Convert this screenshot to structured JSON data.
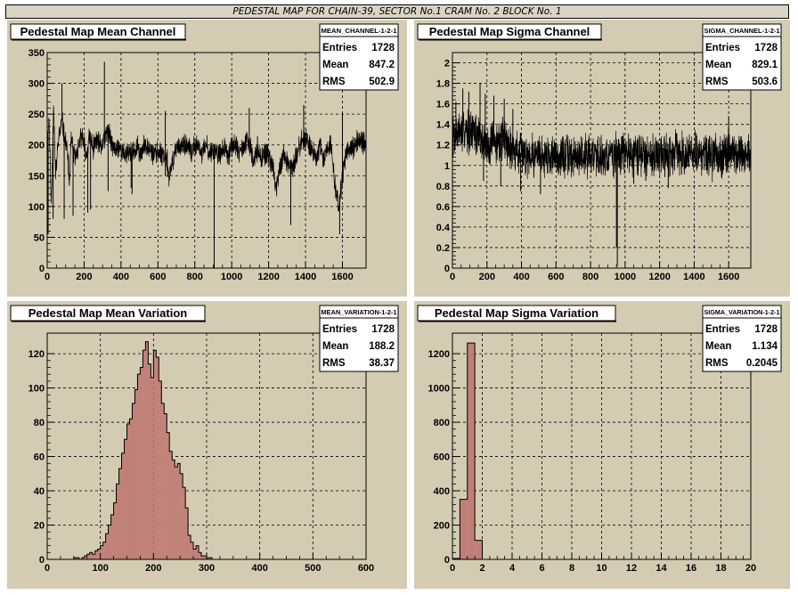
{
  "page": {
    "title": "PEDESTAL MAP FOR CHAIN-39, SECTOR No.1 CRAM No. 2 BLOCK No. 1"
  },
  "colors": {
    "pad_background": "#d4cbb3",
    "histogram_fill": "#c08078",
    "line": "#000000"
  },
  "chart_data": [
    {
      "type": "line",
      "title": "Pedestal Map Mean Channel",
      "stats": {
        "name": "MEAN_CHANNEL-1-2-1",
        "entries": "1728",
        "mean": "847.2",
        "rms": "502.9"
      },
      "xlim": [
        0,
        1728
      ],
      "ylim": [
        0,
        350
      ],
      "xticks": [
        0,
        200,
        400,
        600,
        800,
        1000,
        1200,
        1400,
        1600
      ],
      "yticks": [
        0,
        50,
        100,
        150,
        200,
        250,
        300,
        350
      ],
      "grid": true,
      "stats_placement": "top-right",
      "profile": [
        [
          0,
          190
        ],
        [
          10,
          245
        ],
        [
          22,
          100
        ],
        [
          35,
          270
        ],
        [
          45,
          150
        ],
        [
          60,
          205
        ],
        [
          80,
          240
        ],
        [
          95,
          210
        ],
        [
          110,
          190
        ],
        [
          120,
          135
        ],
        [
          130,
          210
        ],
        [
          150,
          175
        ],
        [
          170,
          200
        ],
        [
          190,
          215
        ],
        [
          210,
          180
        ],
        [
          230,
          215
        ],
        [
          250,
          195
        ],
        [
          270,
          210
        ],
        [
          290,
          195
        ],
        [
          310,
          210
        ],
        [
          330,
          225
        ],
        [
          350,
          200
        ],
        [
          370,
          190
        ],
        [
          390,
          200
        ],
        [
          410,
          185
        ],
        [
          430,
          185
        ],
        [
          450,
          190
        ],
        [
          470,
          185
        ],
        [
          490,
          195
        ],
        [
          510,
          185
        ],
        [
          530,
          200
        ],
        [
          550,
          200
        ],
        [
          570,
          185
        ],
        [
          590,
          185
        ],
        [
          610,
          190
        ],
        [
          630,
          185
        ],
        [
          650,
          180
        ],
        [
          660,
          140
        ],
        [
          680,
          175
        ],
        [
          700,
          195
        ],
        [
          720,
          200
        ],
        [
          740,
          195
        ],
        [
          760,
          200
        ],
        [
          780,
          185
        ],
        [
          800,
          200
        ],
        [
          820,
          195
        ],
        [
          840,
          185
        ],
        [
          860,
          200
        ],
        [
          880,
          185
        ],
        [
          900,
          195
        ],
        [
          920,
          190
        ],
        [
          940,
          185
        ],
        [
          960,
          195
        ],
        [
          980,
          180
        ],
        [
          1000,
          200
        ],
        [
          1020,
          200
        ],
        [
          1040,
          185
        ],
        [
          1060,
          195
        ],
        [
          1080,
          205
        ],
        [
          1100,
          195
        ],
        [
          1120,
          175
        ],
        [
          1140,
          195
        ],
        [
          1160,
          180
        ],
        [
          1180,
          185
        ],
        [
          1200,
          180
        ],
        [
          1220,
          170
        ],
        [
          1240,
          130
        ],
        [
          1260,
          160
        ],
        [
          1280,
          185
        ],
        [
          1300,
          175
        ],
        [
          1320,
          165
        ],
        [
          1340,
          165
        ],
        [
          1360,
          195
        ],
        [
          1380,
          205
        ],
        [
          1400,
          210
        ],
        [
          1420,
          200
        ],
        [
          1440,
          190
        ],
        [
          1460,
          175
        ],
        [
          1480,
          200
        ],
        [
          1500,
          170
        ],
        [
          1520,
          200
        ],
        [
          1540,
          200
        ],
        [
          1560,
          135
        ],
        [
          1580,
          100
        ],
        [
          1600,
          145
        ],
        [
          1620,
          190
        ],
        [
          1640,
          195
        ],
        [
          1660,
          195
        ],
        [
          1680,
          205
        ],
        [
          1700,
          205
        ],
        [
          1728,
          205
        ]
      ],
      "spikes": [
        [
          5,
          55
        ],
        [
          32,
          80
        ],
        [
          80,
          300
        ],
        [
          92,
          80
        ],
        [
          140,
          85
        ],
        [
          220,
          90
        ],
        [
          235,
          95
        ],
        [
          310,
          335
        ],
        [
          330,
          125
        ],
        [
          455,
          130
        ],
        [
          460,
          120
        ],
        [
          640,
          150
        ],
        [
          640,
          255
        ],
        [
          905,
          0
        ],
        [
          1095,
          260
        ],
        [
          1320,
          70
        ],
        [
          1390,
          265
        ],
        [
          1585,
          55
        ],
        [
          1600,
          250
        ]
      ],
      "noise": 14,
      "seed": 11
    },
    {
      "type": "line",
      "title": "Pedestal Map Sigma Channel",
      "stats": {
        "name": "SIGMA_CHANNEL-1-2-1",
        "entries": "1728",
        "mean": "829.1",
        "rms": "503.6"
      },
      "xlim": [
        0,
        1728
      ],
      "ylim": [
        0,
        2.1
      ],
      "xticks": [
        0,
        200,
        400,
        600,
        800,
        1000,
        1200,
        1400,
        1600
      ],
      "yticks": [
        0,
        0.2,
        0.4,
        0.6,
        0.8,
        1.0,
        1.2,
        1.4,
        1.6,
        1.8,
        2.0
      ],
      "ytick_labels": [
        "0",
        "0.2",
        "0.4",
        "0.6",
        "0.8",
        "1",
        "1.2",
        "1.4",
        "1.6",
        "1.8",
        "2"
      ],
      "grid": true,
      "stats_placement": "top-right",
      "profile": [
        [
          0,
          1.3
        ],
        [
          50,
          1.32
        ],
        [
          100,
          1.35
        ],
        [
          150,
          1.28
        ],
        [
          200,
          1.2
        ],
        [
          250,
          1.22
        ],
        [
          300,
          1.28
        ],
        [
          350,
          1.15
        ],
        [
          400,
          1.12
        ],
        [
          450,
          1.12
        ],
        [
          500,
          1.1
        ],
        [
          600,
          1.1
        ],
        [
          700,
          1.08
        ],
        [
          800,
          1.12
        ],
        [
          900,
          1.08
        ],
        [
          1000,
          1.12
        ],
        [
          1100,
          1.1
        ],
        [
          1200,
          1.1
        ],
        [
          1300,
          1.12
        ],
        [
          1400,
          1.1
        ],
        [
          1500,
          1.08
        ],
        [
          1600,
          1.12
        ],
        [
          1728,
          1.1
        ]
      ],
      "spikes": [
        [
          20,
          1.62
        ],
        [
          60,
          1.75
        ],
        [
          95,
          1.72
        ],
        [
          160,
          1.8
        ],
        [
          190,
          1.7
        ],
        [
          240,
          1.68
        ],
        [
          300,
          1.65
        ],
        [
          350,
          1.55
        ],
        [
          180,
          0.85
        ],
        [
          280,
          0.8
        ],
        [
          395,
          0.75
        ],
        [
          510,
          0.72
        ],
        [
          950,
          0.2
        ],
        [
          955,
          0.02
        ],
        [
          1050,
          0.82
        ],
        [
          1120,
          0.85
        ],
        [
          1250,
          0.78
        ],
        [
          1600,
          1.48
        ]
      ],
      "noise": 0.16,
      "seed": 7
    },
    {
      "type": "bar",
      "title": "Pedestal Map Mean Variation",
      "stats": {
        "name": "MEAN_VARIATION-1-2-1",
        "entries": "1728",
        "mean": "188.2",
        "rms": "38.37"
      },
      "xlim": [
        0,
        600
      ],
      "ylim": [
        0,
        132
      ],
      "xticks": [
        0,
        100,
        200,
        300,
        400,
        500,
        600
      ],
      "yticks": [
        0,
        20,
        40,
        60,
        80,
        100,
        120
      ],
      "grid": true,
      "stats_placement": "top-right",
      "bin_width": 5,
      "bin_start": 50,
      "values": [
        1,
        1,
        0,
        1,
        2,
        3,
        4,
        3,
        5,
        6,
        8,
        10,
        15,
        20,
        26,
        33,
        44,
        53,
        62,
        70,
        79,
        82,
        91,
        99,
        108,
        112,
        122,
        127,
        114,
        106,
        122,
        118,
        104,
        91,
        85,
        74,
        63,
        58,
        54,
        56,
        50,
        42,
        30,
        14,
        10,
        6,
        8,
        4,
        2,
        2,
        1,
        1
      ]
    },
    {
      "type": "bar",
      "title": "Pedestal Map Sigma Variation",
      "stats": {
        "name": "SIGMA_VARIATION-1-2-1",
        "entries": "1728",
        "mean": "1.134",
        "rms": "0.2045"
      },
      "xlim": [
        0,
        20
      ],
      "ylim": [
        0,
        1320
      ],
      "xticks": [
        0,
        2,
        4,
        6,
        8,
        10,
        12,
        14,
        16,
        18,
        20
      ],
      "yticks": [
        0,
        200,
        400,
        600,
        800,
        1000,
        1200
      ],
      "grid": true,
      "stats_placement": "top-right",
      "bin_width": 0.5,
      "bin_start": 0,
      "values": [
        5,
        350,
        1262,
        111
      ]
    }
  ]
}
